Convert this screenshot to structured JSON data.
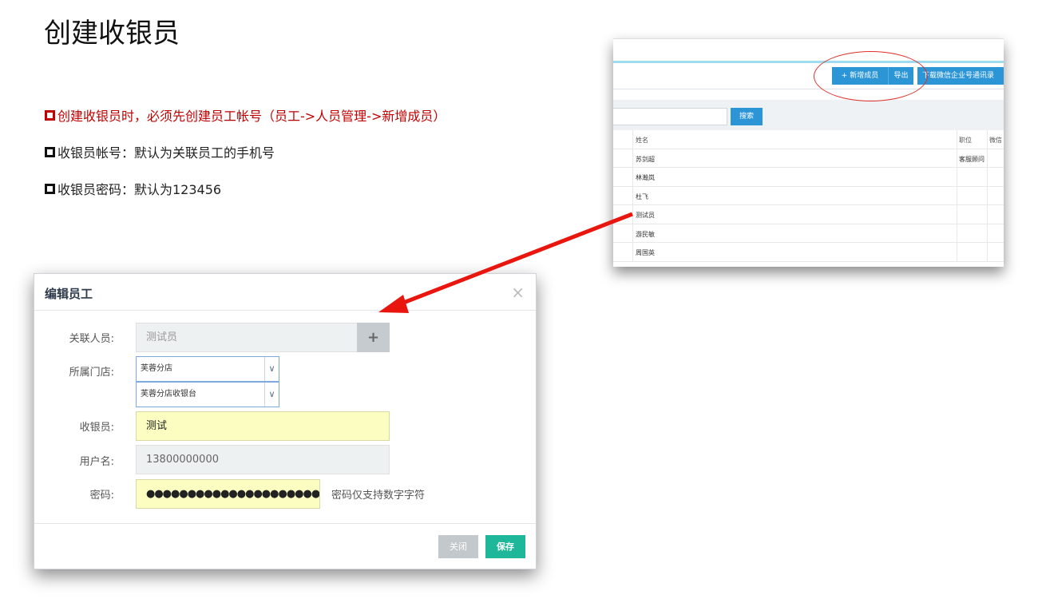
{
  "slide": {
    "title": "创建收银员",
    "bullets": [
      "创建收银员时，必须先创建员工帐号（员工->人员管理->新增成员）",
      "收银员帐号：默认为关联员工的手机号",
      "收银员密码：默认为123456"
    ]
  },
  "list_screenshot": {
    "toolbar": {
      "add_label": "新增成员",
      "add_icon": "+",
      "export_label": "导出",
      "download_label": "下载微信企业号通讯录"
    },
    "search": {
      "button_label": "搜索"
    },
    "columns": {
      "name": "姓名",
      "position": "职位",
      "wechat": "微信"
    },
    "rows": [
      {
        "name": "苏剑超",
        "position": "客服顾问"
      },
      {
        "name": "林瀚岚",
        "position": ""
      },
      {
        "name": "杜飞",
        "position": ""
      },
      {
        "name": "测试员",
        "position": ""
      },
      {
        "name": "游民敏",
        "position": ""
      },
      {
        "name": "周国英",
        "position": ""
      }
    ]
  },
  "dialog": {
    "title": "编辑员工",
    "close_icon": "×",
    "fields": {
      "related_person_label": "关联人员:",
      "related_person_value": "测试员",
      "add_icon": "+",
      "store_label": "所属门店:",
      "store_value": "芙蓉分店",
      "register_value": "芙蓉分店收银台",
      "cashier_label": "收银员:",
      "cashier_value": "测试",
      "username_label": "用户名:",
      "username_value": "13800000000",
      "password_label": "密码:",
      "password_mask": "●●●●●●●●●●●●●●●●●●●●●●●●●●●",
      "password_hint": "密码仅支持数字字符"
    },
    "buttons": {
      "close_label": "关闭",
      "save_label": "保存"
    }
  },
  "colors": {
    "accent_red": "#c00000",
    "annotation_red": "#e0302a",
    "primary_blue": "#2b95d6",
    "save_green": "#1fb79a",
    "input_yellow": "#fbfdc1"
  }
}
